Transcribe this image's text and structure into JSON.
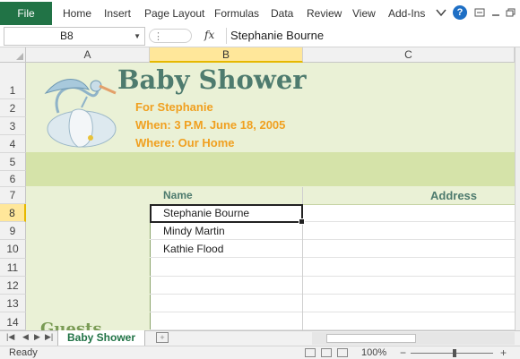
{
  "ribbon": {
    "file_tab": "File",
    "tabs": [
      "Home",
      "Insert",
      "Page Layout",
      "Formulas",
      "Data",
      "Review",
      "View",
      "Add-Ins"
    ],
    "help_glyph": "?",
    "icons": [
      "heart-icon",
      "help-icon",
      "ribbon-options-icon",
      "minimize-icon",
      "restore-icon"
    ]
  },
  "formula_bar": {
    "name_box": "B8",
    "fx_label": "fx",
    "value": "Stephanie Bourne"
  },
  "columns": [
    "A",
    "B",
    "C"
  ],
  "rows": [
    "1",
    "2",
    "3",
    "4",
    "5",
    "6",
    "7",
    "8",
    "9",
    "10",
    "11",
    "12",
    "13",
    "14"
  ],
  "active": {
    "column": "B",
    "row": "8"
  },
  "sheet": {
    "title": "Baby Shower",
    "for_line": "For Stephanie",
    "when_line": "When:  3 P.M. June 18, 2005",
    "where_line": "Where: Our Home",
    "header_name": "Name",
    "header_address": "Address",
    "names": [
      "Stephanie Bourne",
      "Mindy Martin",
      "Kathie Flood"
    ],
    "side_label": "Guests",
    "accent_color": "#4e7b6e",
    "highlight_color": "#f0a020"
  },
  "tabs_bar": {
    "sheet_name": "Baby Shower"
  },
  "status_bar": {
    "status": "Ready",
    "zoom": "100%"
  }
}
